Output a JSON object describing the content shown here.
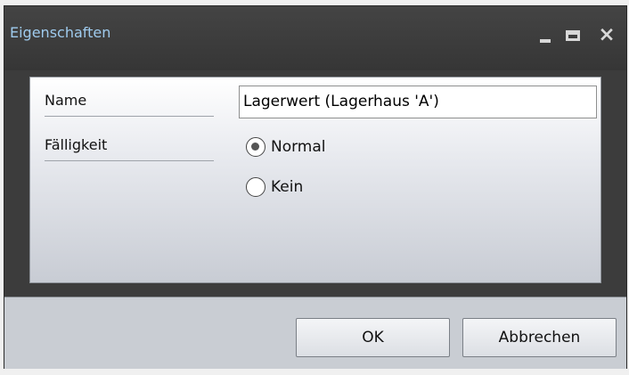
{
  "window": {
    "title": "Eigenschaften"
  },
  "form": {
    "name_label": "Name",
    "name_value": "Lagerwert (Lagerhaus 'A')",
    "due_label": "Fälligkeit",
    "radio_options": [
      {
        "label": "Normal",
        "selected": true
      },
      {
        "label": "Kein",
        "selected": false
      }
    ]
  },
  "buttons": {
    "ok": "OK",
    "cancel": "Abbrechen"
  },
  "icons": {
    "minimize": "minimize-icon",
    "maximize": "maximize-icon",
    "close": "close-icon"
  },
  "colors": {
    "title_text": "#9fcbee",
    "titlebar_bg": "#3c3c3c",
    "content_bg": "#e7e9ee"
  }
}
